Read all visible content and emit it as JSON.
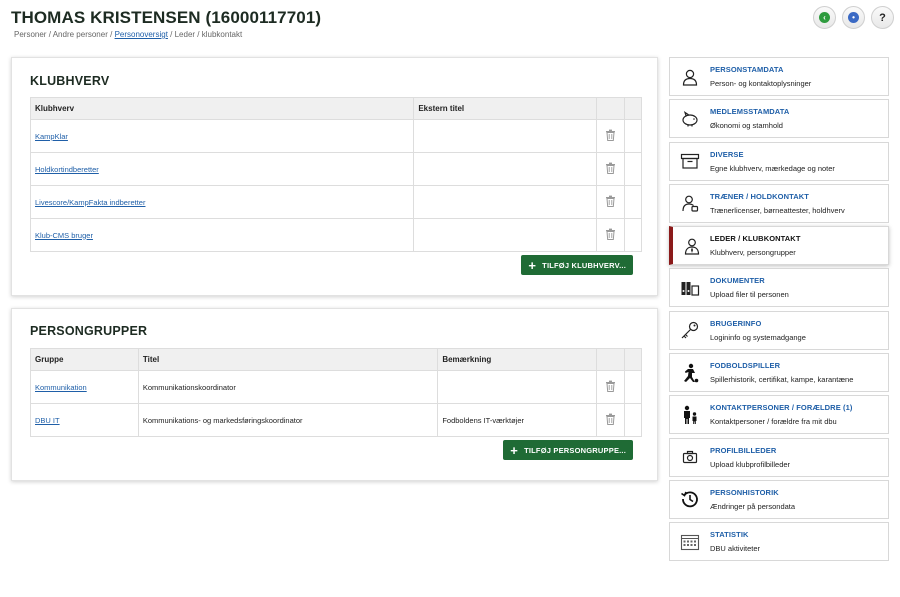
{
  "header": {
    "title": "THOMAS KRISTENSEN (16000117701)",
    "breadcrumb": [
      "Personer",
      "Andre personer",
      "Personoversigt",
      "Leder / klubkontakt"
    ],
    "help_label": "?"
  },
  "klubhverv": {
    "heading": "KLUBHVERV",
    "columns": [
      "Klubhverv",
      "Ekstern titel"
    ],
    "rows": [
      {
        "name": "KampKlar",
        "ekstern_titel": ""
      },
      {
        "name": "Holdkortindberetter",
        "ekstern_titel": ""
      },
      {
        "name": "Livescore/KampFakta indberetter",
        "ekstern_titel": ""
      },
      {
        "name": "Klub-CMS bruger",
        "ekstern_titel": ""
      }
    ],
    "add_label": "TILFØJ KLUBHVERV..."
  },
  "persongrupper": {
    "heading": "PERSONGRUPPER",
    "columns": [
      "Gruppe",
      "Titel",
      "Bemærkning"
    ],
    "rows": [
      {
        "gruppe": "Kommunikation",
        "titel": "Kommunikationskoordinator",
        "bemaerkning": ""
      },
      {
        "gruppe": "DBU IT",
        "titel": "Kommunikations- og markedsføringskoordinator",
        "bemaerkning": "Fodboldens IT-værktøjer"
      }
    ],
    "add_label": "TILFØJ PERSONGRUPPE..."
  },
  "nav": [
    {
      "title": "PERSONSTAMDATA",
      "sub": "Person- og kontaktoplysninger",
      "icon": "person-icon",
      "active": false
    },
    {
      "title": "MEDLEMSSTAMDATA",
      "sub": "Økonomi og stamhold",
      "icon": "piggy-bank-icon",
      "active": false
    },
    {
      "title": "DIVERSE",
      "sub": "Egne klubhverv, mærkedage og noter",
      "icon": "archive-box-icon",
      "active": false
    },
    {
      "title": "TRÆNER / HOLDKONTAKT",
      "sub": "Trænerlicenser, børneattester, holdhverv",
      "icon": "coach-icon",
      "active": false
    },
    {
      "title": "LEDER / KLUBKONTAKT",
      "sub": "Klubhverv, persongrupper",
      "icon": "leader-icon",
      "active": true
    },
    {
      "title": "DOKUMENTER",
      "sub": "Upload filer til personen",
      "icon": "binders-icon",
      "active": false
    },
    {
      "title": "BRUGERINFO",
      "sub": "Logininfo og systemadgange",
      "icon": "key-icon",
      "active": false
    },
    {
      "title": "FODBOLDSPILLER",
      "sub": "Spillerhistorik, certifikat, kampe, karantæne",
      "icon": "football-player-icon",
      "active": false
    },
    {
      "title": "KONTAKTPERSONER / FORÆLDRE (1)",
      "sub": "Kontaktpersoner / forældre fra mit dbu",
      "icon": "parent-child-icon",
      "active": false
    },
    {
      "title": "PROFILBILLEDER",
      "sub": "Upload klubprofilbilleder",
      "icon": "camera-icon",
      "active": false
    },
    {
      "title": "PERSONHISTORIK",
      "sub": "Ændringer på persondata",
      "icon": "history-icon",
      "active": false
    },
    {
      "title": "STATISTIK",
      "sub": "DBU aktiviteter",
      "icon": "calendar-icon",
      "active": false
    }
  ]
}
